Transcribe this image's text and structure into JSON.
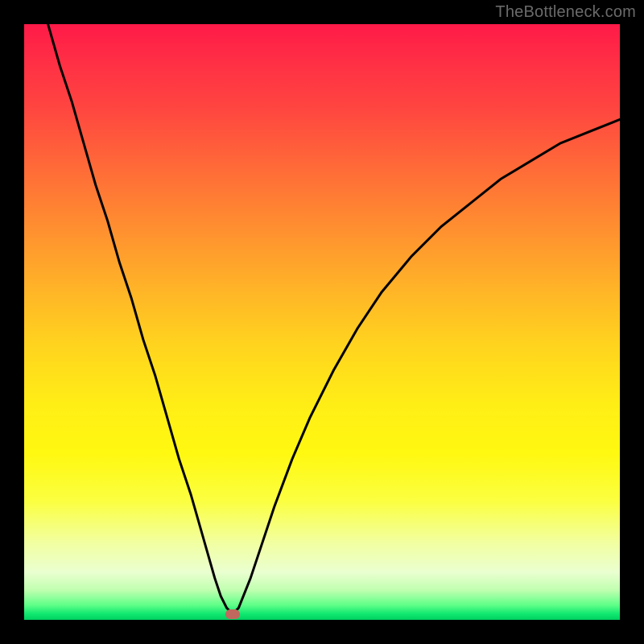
{
  "watermark": "TheBottleneck.com",
  "chart_data": {
    "type": "line",
    "title": "",
    "xlabel": "",
    "ylabel": "",
    "xlim": [
      0,
      100
    ],
    "ylim": [
      0,
      100
    ],
    "grid": false,
    "series": [
      {
        "name": "bottleneck-curve",
        "x": [
          4,
          6,
          8,
          10,
          12,
          14,
          16,
          18,
          20,
          22,
          24,
          26,
          28,
          30,
          32,
          33,
          34,
          35,
          36,
          38,
          40,
          42,
          45,
          48,
          52,
          56,
          60,
          65,
          70,
          75,
          80,
          85,
          90,
          95,
          100
        ],
        "y": [
          100,
          93,
          87,
          80,
          73,
          67,
          60,
          54,
          47,
          41,
          34,
          27,
          21,
          14,
          7,
          4,
          2,
          1,
          2,
          7,
          13,
          19,
          27,
          34,
          42,
          49,
          55,
          61,
          66,
          70,
          74,
          77,
          80,
          82,
          84
        ]
      }
    ],
    "marker": {
      "x": 35,
      "y": 1
    },
    "background_gradient": {
      "top_color": "#ff1a48",
      "mid_color": "#ffee16",
      "bottom_color": "#00d060"
    }
  }
}
